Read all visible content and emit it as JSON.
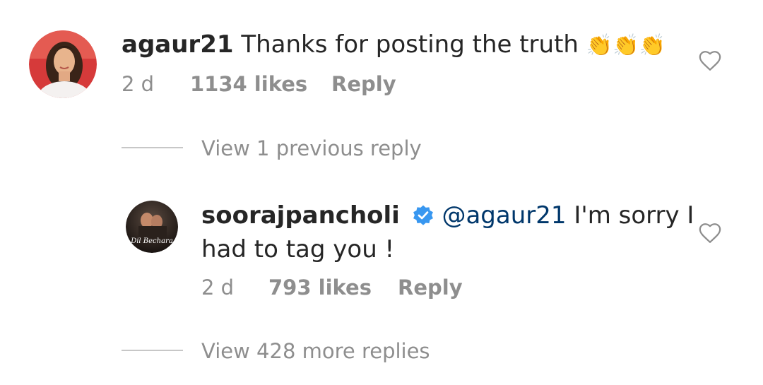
{
  "comment": {
    "username": "agaur21",
    "text": "Thanks for posting the truth",
    "emoji": "👏👏👏",
    "time": "2 d",
    "likes": "1134 likes",
    "reply_label": "Reply",
    "like_icon": "heart-outline-icon"
  },
  "thread_toggle_previous": "View 1 previous reply",
  "reply": {
    "username": "soorajpancholi",
    "verified_icon": "verified-badge-icon",
    "verified_color": "#3897f0",
    "mention": "@agaur21",
    "text_line1": " I'm sorry I",
    "text_line2": "had to tag you !",
    "avatar_text": "Dil Bechara",
    "time": "2 d",
    "likes": "793 likes",
    "reply_label": "Reply",
    "like_icon": "heart-outline-icon"
  },
  "thread_toggle_more": "View 428 more replies"
}
